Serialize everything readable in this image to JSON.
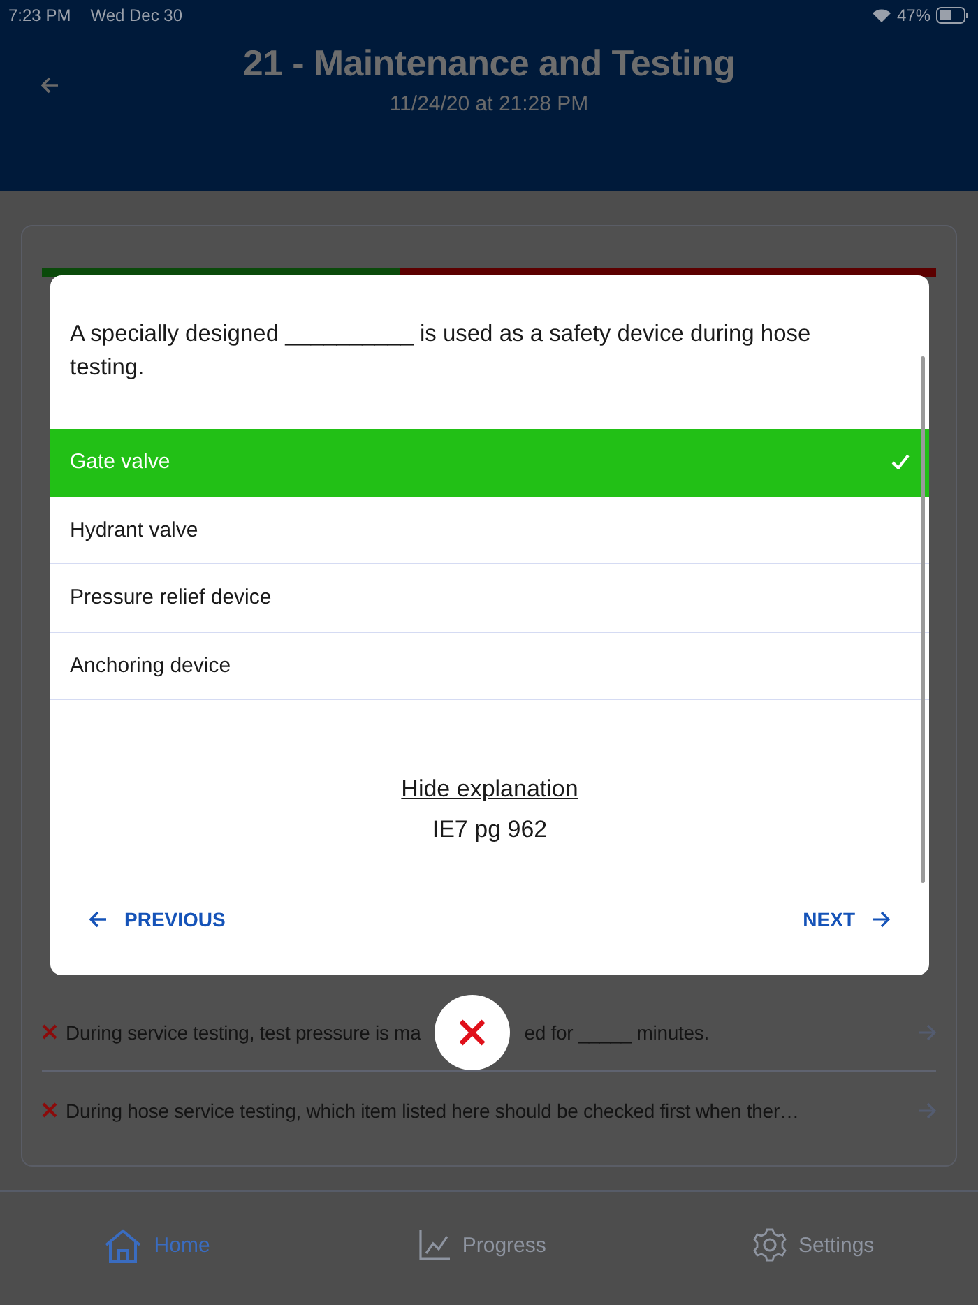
{
  "status_bar": {
    "time": "7:23 PM",
    "date": "Wed Dec 30",
    "battery": "47%"
  },
  "header": {
    "title": "21 - Maintenance and Testing",
    "subtitle": "11/24/20 at 21:28 PM"
  },
  "score_bar": {
    "level": 0.4
  },
  "results": [
    {
      "kind": "split",
      "correct": false,
      "text_before": "During service testing, test pressure is ma",
      "text_after": "ed for _____ minutes."
    },
    {
      "kind": "full",
      "correct": false,
      "text": "During hose service testing, which item listed here should be checked first when ther…"
    }
  ],
  "modal": {
    "question": "A specially designed __________ is used as a safety device during hose testing.",
    "options": [
      {
        "label": "Gate valve",
        "selected": true
      },
      {
        "label": "Hydrant valve",
        "selected": false
      },
      {
        "label": "Pressure relief device",
        "selected": false
      },
      {
        "label": "Anchoring device",
        "selected": false
      }
    ],
    "explanation_link": "Hide explanation",
    "explanation": "IE7 pg 962",
    "previous": "PREVIOUS",
    "next": "NEXT"
  },
  "tabs": [
    {
      "label": "Home",
      "selected": true
    },
    {
      "label": "Progress",
      "selected": false
    },
    {
      "label": "Settings",
      "selected": false
    }
  ]
}
